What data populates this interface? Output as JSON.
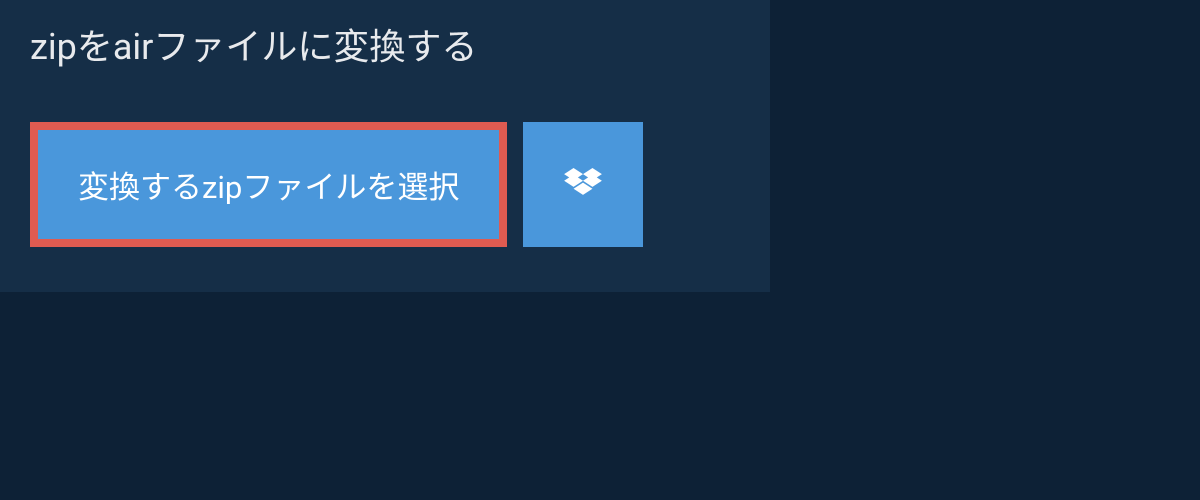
{
  "heading": "zipをairファイルに変換する",
  "buttons": {
    "select_file": "変換するzipファイルを選択"
  },
  "colors": {
    "background": "#0d2136",
    "panel": "#152e47",
    "button": "#4a97db",
    "highlight_border": "#df5b51",
    "text": "#e8eaed"
  }
}
